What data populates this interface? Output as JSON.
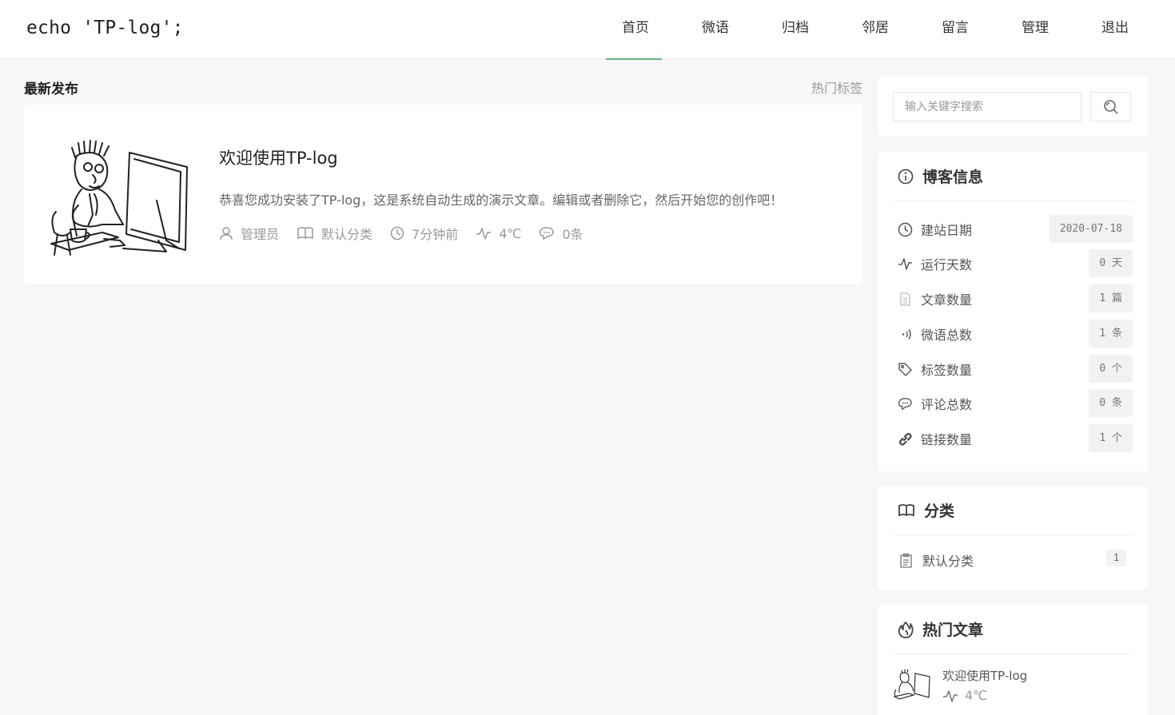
{
  "header": {
    "logo": "echo 'TP-log';",
    "nav": [
      "首页",
      "微语",
      "归档",
      "邻居",
      "留言",
      "管理",
      "退出"
    ]
  },
  "main": {
    "section_title": "最新发布",
    "hot_tags_label": "热门标签",
    "post": {
      "title": "欢迎使用TP-log",
      "excerpt": "恭喜您成功安装了TP-log，这是系统自动生成的演示文章。编辑或者删除它，然后开始您的创作吧！",
      "author": "管理员",
      "category": "默认分类",
      "time": "7分钟前",
      "heat": "4℃",
      "comments": "0条"
    }
  },
  "sidebar": {
    "search_placeholder": "输入关键字搜索",
    "blog_info": {
      "title": "博客信息",
      "rows": [
        {
          "label": "建站日期",
          "value": "2020-07-18",
          "icon": "clock-icon"
        },
        {
          "label": "运行天数",
          "value": "0 天",
          "icon": "pulse-icon"
        },
        {
          "label": "文章数量",
          "value": "1 篇",
          "icon": "document-icon"
        },
        {
          "label": "微语总数",
          "value": "1 条",
          "icon": "broadcast-icon"
        },
        {
          "label": "标签数量",
          "value": "0 个",
          "icon": "tag-icon"
        },
        {
          "label": "评论总数",
          "value": "0 条",
          "icon": "comment-icon"
        },
        {
          "label": "链接数量",
          "value": "1 个",
          "icon": "link-icon"
        }
      ]
    },
    "categories": {
      "title": "分类",
      "items": [
        {
          "label": "默认分类",
          "count": "1"
        }
      ]
    },
    "hot_posts": {
      "title": "热门文章",
      "items": [
        {
          "title": "欢迎使用TP-log",
          "heat": "4℃"
        }
      ]
    }
  },
  "colors": {
    "accent": "#5fb878",
    "background": "#f7f7f7",
    "card": "#ffffff",
    "badge": "#f2f2f2"
  }
}
